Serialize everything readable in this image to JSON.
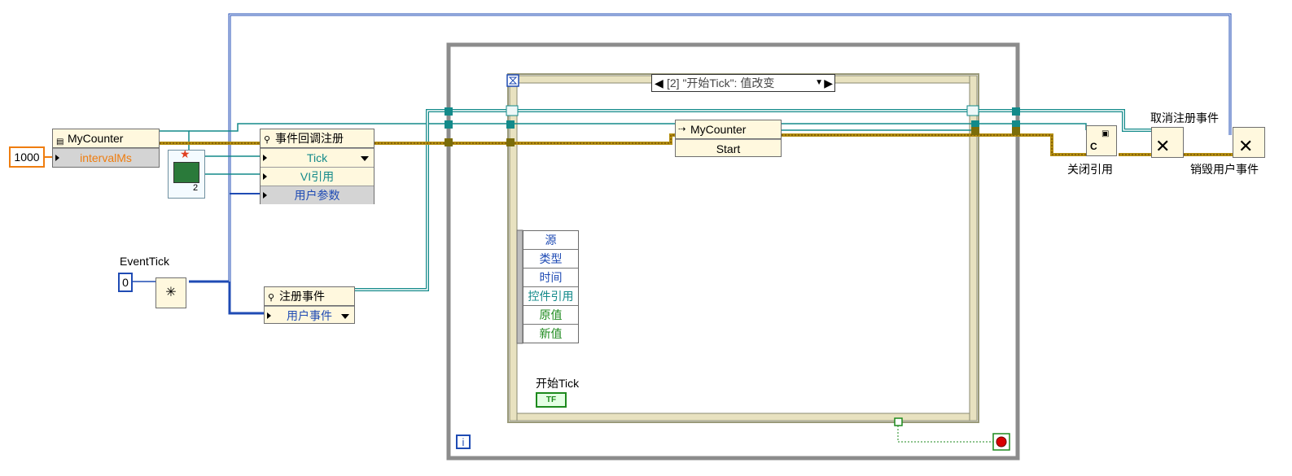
{
  "constants": {
    "interval_value": "1000",
    "event_tick_value": "0"
  },
  "labels": {
    "event_tick": "EventTick",
    "start_tick": "开始Tick",
    "close_ref": "关闭引用",
    "unregister": "取消注册事件",
    "destroy_user_event": "销毁用户事件"
  },
  "mycounter_unbundle": {
    "title": "MyCounter",
    "field": "intervalMs"
  },
  "callback_register": {
    "title": "事件回调注册",
    "rows": [
      "Tick",
      "VI引用",
      "用户参数"
    ]
  },
  "register_events": {
    "title": "注册事件",
    "row": "用户事件"
  },
  "event_case": {
    "selector": "[2] \"开始Tick\": 值改变"
  },
  "event_data": {
    "items": [
      "源",
      "类型",
      "时间",
      "控件引用",
      "原值",
      "新值"
    ]
  },
  "invoke": {
    "title": "MyCounter",
    "method": "Start"
  },
  "vi_ref": {
    "index": "2"
  },
  "loop": {
    "iteration": "i"
  },
  "bool_const": {
    "text": "TF"
  },
  "close_node": {
    "text": "C"
  },
  "colors": {
    "wire_blue": "#1f4bb4",
    "wire_teal": "#138a8a",
    "wire_yellow": "#b58f10",
    "wire_brown": "#7b4a0c",
    "loop_gray": "#8a8a8a",
    "node_fill": "#fff8de",
    "accent_orange": "#ef7d0f",
    "terminal_green": "#1d8a1d"
  }
}
